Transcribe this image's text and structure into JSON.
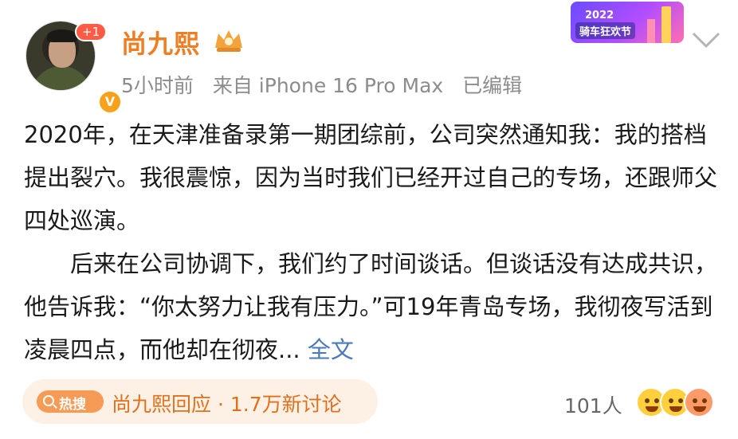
{
  "post": {
    "author": {
      "name": "尚九熙",
      "follow_badge": "+1"
    },
    "meta": {
      "time": "5小时前",
      "source": "来自 iPhone 16 Pro Max",
      "edited": "已编辑"
    },
    "event_badge": {
      "year": "2022",
      "title": "骑车狂欢节"
    },
    "paragraphs": [
      "2020年，在天津准备录第一期团综前，公司突然通知我：我的搭档提出裂穴。我很震惊，因为当时我们已经开过自己的专场，还跟师父四处巡演。",
      "后来在公司协调下，我们约了时间谈话。但谈话没有达成共识，他告诉我：“你太努力让我有压力。”可19年青岛专场，我彻夜写活到凌晨四点，而他却在彻夜... "
    ],
    "full_text_link": "全文",
    "hot_search": {
      "tag": "热搜",
      "text": "尚九熙回应 · 1.7万新讨论"
    },
    "reactions": {
      "count": "101人"
    }
  },
  "colors": {
    "username": "#f07d22",
    "link": "#4a7ab8",
    "hot_bg": "#fdf1e6",
    "hot_text": "#e1701c"
  }
}
